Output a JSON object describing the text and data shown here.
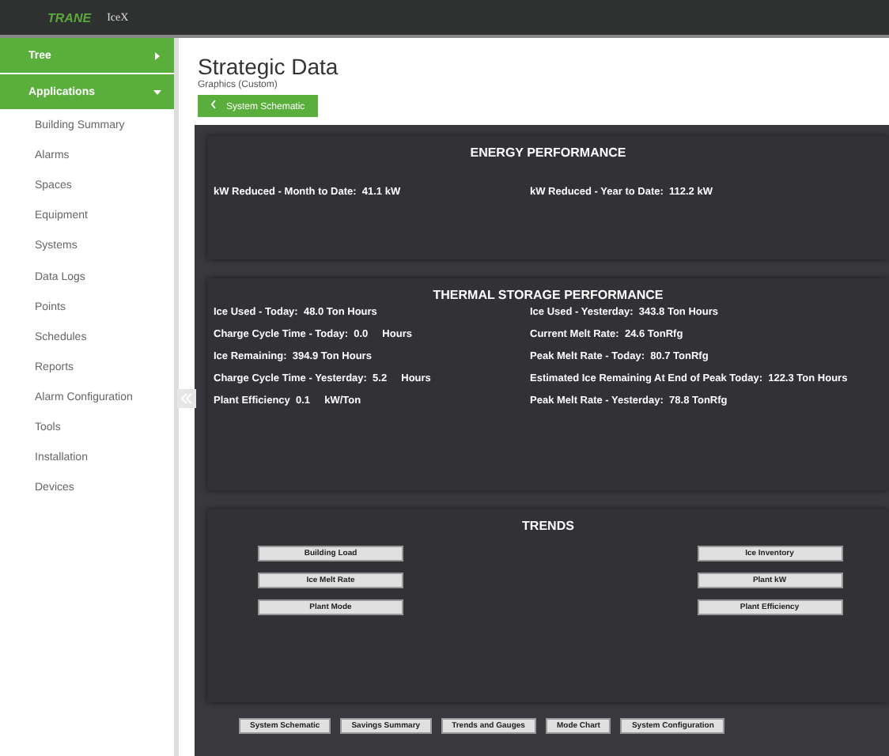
{
  "topbar": {
    "logo": "TRANE",
    "app": "IceX"
  },
  "sidebar": {
    "sections": [
      {
        "label": "Tree",
        "expanded": false
      },
      {
        "label": "Applications",
        "expanded": true
      }
    ],
    "items": [
      "Building Summary",
      "Alarms",
      "Spaces",
      "Equipment",
      "Systems",
      "Data Logs",
      "Points",
      "Schedules",
      "Reports",
      "Alarm Configuration",
      "Tools",
      "Installation",
      "Devices"
    ]
  },
  "page": {
    "title": "Strategic Data",
    "subtitle": "Graphics (Custom)",
    "back_button": "System Schematic"
  },
  "energy": {
    "title": "ENERGY PERFORMANCE",
    "left": [
      "kW Reduced - Month to Date:  41.1 kW"
    ],
    "right": [
      "kW Reduced - Year to Date:  112.2 kW"
    ]
  },
  "thermal": {
    "title": "THERMAL STORAGE PERFORMANCE",
    "left": [
      "Ice Used - Today:  48.0 Ton Hours",
      "Charge Cycle Time - Today:  0.0     Hours",
      "Ice Remaining:  394.9 Ton Hours",
      "Charge Cycle Time - Yesterday:  5.2     Hours",
      "Plant Efficiency  0.1     kW/Ton"
    ],
    "right": [
      "Ice Used - Yesterday:  343.8 Ton Hours",
      "Current Melt Rate:  24.6 TonRfg",
      "Peak Melt Rate - Today:  80.7 TonRfg",
      "Estimated Ice Remaining At End of Peak Today:  122.3 Ton Hours",
      "Peak Melt Rate - Yesterday:  78.8 TonRfg"
    ]
  },
  "trends": {
    "title": "TRENDS",
    "left": [
      "Building Load",
      "Ice Melt Rate",
      "Plant Mode"
    ],
    "right": [
      "Ice Inventory",
      "Plant kW",
      "Plant Efficiency"
    ]
  },
  "nav_buttons": [
    "System Schematic",
    "Savings Summary",
    "Trends and Gauges",
    "Mode Chart",
    "System Configuration"
  ]
}
